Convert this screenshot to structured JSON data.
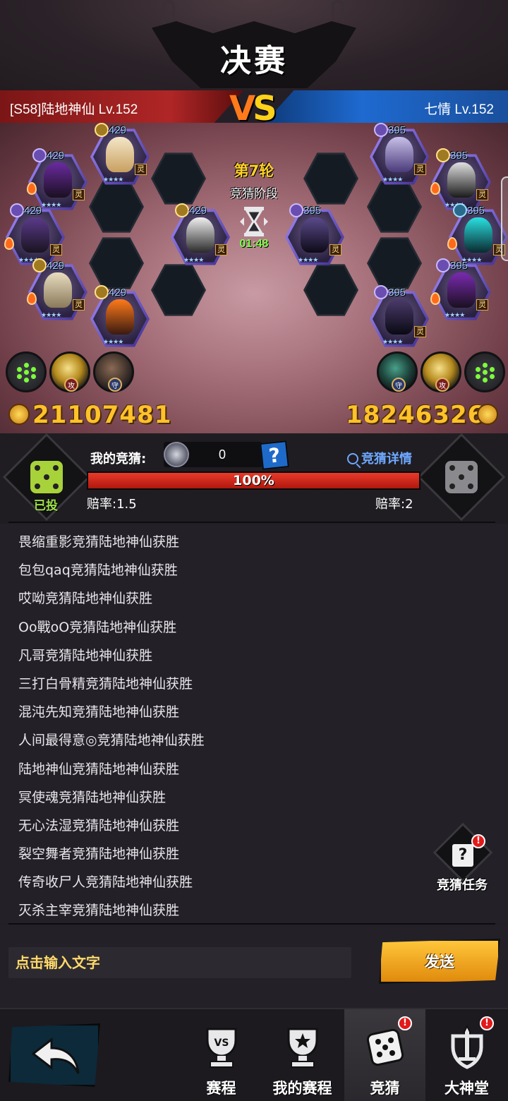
{
  "header": {
    "title": "决赛"
  },
  "matchup": {
    "left_player": "[S58]陆地神仙 Lv.152",
    "right_player": "七情 Lv.152",
    "vs_v": "V",
    "vs_s": "S"
  },
  "arena": {
    "round": "第7轮",
    "phase": "竞猜阶段",
    "timer": "01:48",
    "left_units": [
      "429",
      "429",
      "429",
      "429",
      "429",
      "429"
    ],
    "right_units": [
      "395",
      "395",
      "395",
      "395",
      "395",
      "395"
    ],
    "spirit_tag": "灵",
    "stars": "★★★★"
  },
  "skills": {
    "attack_tag": "攻",
    "defend_tag": "守"
  },
  "power": {
    "left": "21107481",
    "right": "18246326"
  },
  "bet": {
    "voted_label": "已投",
    "my_bet_label": "我的竞猜:",
    "amount": "0",
    "help_label": "?",
    "detail_link": "竞猜详情",
    "progress_percent_text": "100%",
    "progress_value": 1.0,
    "odds_left": "赔率:1.5",
    "odds_right": "赔率:2"
  },
  "feed": [
    "畏缩重影竞猜陆地神仙获胜",
    "包包qaq竞猜陆地神仙获胜",
    "哎呦竞猜陆地神仙获胜",
    "Oo戰oO竞猜陆地神仙获胜",
    "凡哥竞猜陆地神仙获胜",
    "三打白骨精竞猜陆地神仙获胜",
    "混沌先知竞猜陆地神仙获胜",
    "人间最得意◎竞猜陆地神仙获胜",
    "陆地神仙竞猜陆地神仙获胜",
    "冥使魂竞猜陆地神仙获胜",
    "无心法湿竞猜陆地神仙获胜",
    "裂空舞者竞猜陆地神仙获胜",
    "传奇收尸人竞猜陆地神仙获胜",
    "灭杀主宰竞猜陆地神仙获胜"
  ],
  "task": {
    "label": "竞猜任务",
    "alert": "!"
  },
  "chat": {
    "placeholder": "点击输入文字",
    "send_label": "发送"
  },
  "nav": {
    "items": [
      {
        "label": "赛程",
        "icon": "vs-trophy-icon"
      },
      {
        "label": "我的赛程",
        "icon": "star-trophy-icon"
      },
      {
        "label": "竞猜",
        "icon": "dice-icon",
        "active": true,
        "alert": "!"
      },
      {
        "label": "大神堂",
        "icon": "sword-shield-icon",
        "alert": "!"
      }
    ]
  },
  "colors": {
    "left_team": "#b02626",
    "right_team": "#1e6ad0",
    "power": "#ffc22a",
    "timer": "#7fff4a",
    "link": "#6ea8ff"
  }
}
